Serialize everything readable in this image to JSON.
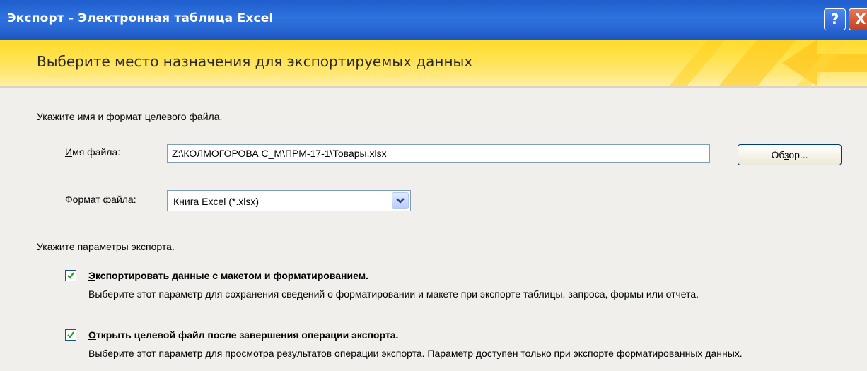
{
  "window": {
    "title": "Экспорт - Электронная таблица Excel",
    "help_glyph": "?",
    "close_glyph": "X"
  },
  "banner": {
    "heading": "Выберите место назначения для экспортируемых данных"
  },
  "file_section": {
    "intro": "Укажите имя и формат целевого файла.",
    "filename_label_accel": "И",
    "filename_label_rest": "мя файла:",
    "filename_value": "Z:\\КОЛМОГОРОВА С_М\\ПРМ-17-1\\Товары.xlsx",
    "browse_prefix": "Об",
    "browse_accel": "з",
    "browse_suffix": "ор...",
    "format_label_accel": "Ф",
    "format_label_rest": "ормат файла:",
    "format_value": "Книга Excel (*.xlsx)"
  },
  "export_options": {
    "intro": "Укажите параметры экспорта.",
    "options": [
      {
        "checked": true,
        "title_accel": "Э",
        "title_rest": "кспортировать данные с макетом и форматированием.",
        "description": "Выберите этот параметр для сохранения сведений о форматировании и макете при экспорте таблицы, запроса, формы или отчета."
      },
      {
        "checked": true,
        "title_accel": "О",
        "title_rest": "ткрыть целевой файл после завершения операции экспорта.",
        "description": "Выберите этот параметр для просмотра результатов операции экспорта. Параметр доступен только при экспорте форматированных данных."
      }
    ]
  },
  "colors": {
    "titlebar": "#2a69d6",
    "banner": "#ffe24e",
    "background": "#f0efeb"
  }
}
